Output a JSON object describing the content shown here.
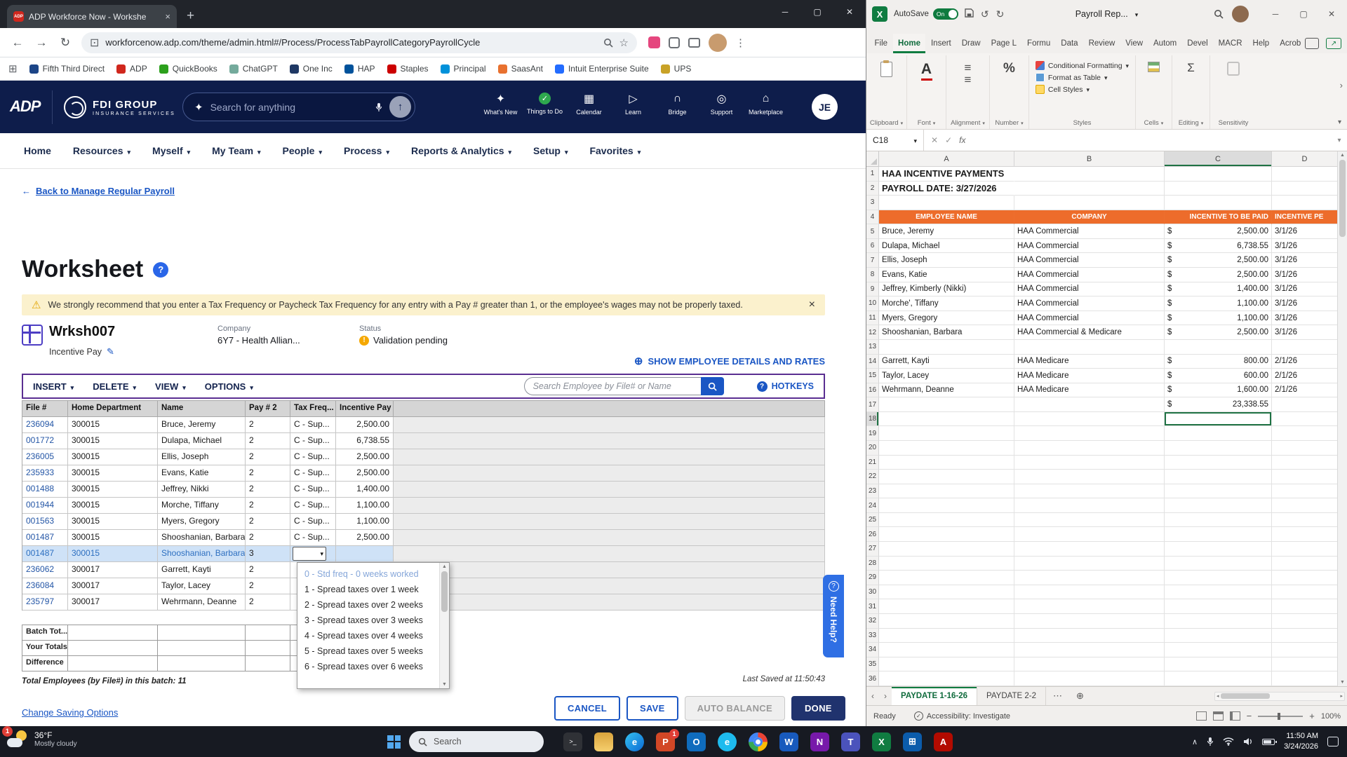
{
  "browser": {
    "tab_title": "ADP Workforce Now - Workshe",
    "tab_favicon": "ADP",
    "url": "workforcenow.adp.com/theme/admin.html#/Process/ProcessTabPayrollCategoryPayrollCycle",
    "bookmarks": [
      {
        "label": "Fifth Third Direct",
        "color": "#1c4587"
      },
      {
        "label": "ADP",
        "color": "#d0271d"
      },
      {
        "label": "QuickBooks",
        "color": "#2ca01c"
      },
      {
        "label": "ChatGPT",
        "color": "#74aa9c"
      },
      {
        "label": "One Inc",
        "color": "#1f3864"
      },
      {
        "label": "HAP",
        "color": "#00529b"
      },
      {
        "label": "Staples",
        "color": "#cc0000"
      },
      {
        "label": "Principal",
        "color": "#0091da"
      },
      {
        "label": "SaasAnt",
        "color": "#e8712f"
      },
      {
        "label": "Intuit Enterprise Suite",
        "color": "#236cff"
      },
      {
        "label": "UPS",
        "color": "#c9a227"
      }
    ]
  },
  "adp": {
    "logo": "ADP",
    "brand_line1": "FDI GROUP",
    "brand_line2": "INSURANCE SERVICES",
    "search_placeholder": "Search for anything",
    "header_items": [
      {
        "label": "What's New",
        "glyph": "✦"
      },
      {
        "label": "Things to Do",
        "glyph": "✓",
        "check": true
      },
      {
        "label": "Calendar",
        "glyph": "▦"
      },
      {
        "label": "Learn",
        "glyph": "▷"
      },
      {
        "label": "Bridge",
        "glyph": "∩"
      },
      {
        "label": "Support",
        "glyph": "◎"
      },
      {
        "label": "Marketplace",
        "glyph": "⌂"
      }
    ],
    "avatar": "JE",
    "nav_items": [
      {
        "label": "Home",
        "caret": false
      },
      {
        "label": "Resources",
        "caret": true
      },
      {
        "label": "Myself",
        "caret": true
      },
      {
        "label": "My Team",
        "caret": true
      },
      {
        "label": "People",
        "caret": true
      },
      {
        "label": "Process",
        "caret": true
      },
      {
        "label": "Reports & Analytics",
        "caret": true
      },
      {
        "label": "Setup",
        "caret": true
      },
      {
        "label": "Favorites",
        "caret": true
      }
    ],
    "back_link": "Back to Manage Regular Payroll",
    "page_title": "Worksheet",
    "warning_text": "We strongly recommend that you enter a Tax Frequency or Paycheck Tax Frequency for any entry with a Pay # greater than 1, or the employee's wages may not be properly taxed.",
    "worksheet_id": "Wrksh007",
    "worksheet_type": "Incentive Pay",
    "company_label": "Company",
    "company_value": "6Y7 - Health Allian...",
    "status_label": "Status",
    "status_value": "Validation pending",
    "show_details_link": "SHOW EMPLOYEE DETAILS AND RATES",
    "menu_buttons": [
      {
        "label": "INSERT"
      },
      {
        "label": "DELETE"
      },
      {
        "label": "VIEW"
      },
      {
        "label": "OPTIONS"
      }
    ],
    "employee_search_placeholder": "Search Employee by File# or Name",
    "hotkeys_label": "HOTKEYS",
    "grid": {
      "headers": [
        "File #",
        "Home Department",
        "Name",
        "Pay # 2",
        "Tax Freq...",
        "Incentive Pay"
      ],
      "rows": [
        {
          "file": "236094",
          "dept": "300015",
          "name": "Bruce, Jeremy",
          "pay": "2",
          "tax": "C - Sup...",
          "incentive": "2,500.00",
          "selected": false,
          "combo": false
        },
        {
          "file": "001772",
          "dept": "300015",
          "name": "Dulapa, Michael",
          "pay": "2",
          "tax": "C - Sup...",
          "incentive": "6,738.55",
          "selected": false,
          "combo": false
        },
        {
          "file": "236005",
          "dept": "300015",
          "name": "Ellis, Joseph",
          "pay": "2",
          "tax": "C - Sup...",
          "incentive": "2,500.00",
          "selected": false,
          "combo": false
        },
        {
          "file": "235933",
          "dept": "300015",
          "name": "Evans, Katie",
          "pay": "2",
          "tax": "C - Sup...",
          "incentive": "2,500.00",
          "selected": false,
          "combo": false
        },
        {
          "file": "001488",
          "dept": "300015",
          "name": "Jeffrey, Nikki",
          "pay": "2",
          "tax": "C - Sup...",
          "incentive": "1,400.00",
          "selected": false,
          "combo": false
        },
        {
          "file": "001944",
          "dept": "300015",
          "name": "Morche, Tiffany",
          "pay": "2",
          "tax": "C - Sup...",
          "incentive": "1,100.00",
          "selected": false,
          "combo": false
        },
        {
          "file": "001563",
          "dept": "300015",
          "name": "Myers, Gregory",
          "pay": "2",
          "tax": "C - Sup...",
          "incentive": "1,100.00",
          "selected": false,
          "combo": false
        },
        {
          "file": "001487",
          "dept": "300015",
          "name": "Shooshanian, Barbara",
          "pay": "2",
          "tax": "C - Sup...",
          "incentive": "2,500.00",
          "selected": false,
          "combo": false
        },
        {
          "file": "001487",
          "dept": "300015",
          "name": "Shooshanian, Barbara",
          "pay": "3",
          "tax": "",
          "incentive": "",
          "selected": true,
          "combo": true
        },
        {
          "file": "236062",
          "dept": "300017",
          "name": "Garrett, Kayti",
          "pay": "2",
          "tax": "",
          "incentive": "",
          "selected": false,
          "combo": false
        },
        {
          "file": "236084",
          "dept": "300017",
          "name": "Taylor, Lacey",
          "pay": "2",
          "tax": "",
          "incentive": "",
          "selected": false,
          "combo": false
        },
        {
          "file": "235797",
          "dept": "300017",
          "name": "Wehrmann, Deanne",
          "pay": "2",
          "tax": "",
          "incentive": "",
          "selected": false,
          "combo": false
        }
      ],
      "footer_rows": [
        {
          "label": "Batch Tot..."
        },
        {
          "label": "Your Totals"
        },
        {
          "label": "Difference"
        }
      ]
    },
    "tax_freq_options": [
      {
        "label": "0 - Std freq - 0 weeks worked",
        "hl": true
      },
      {
        "label": "1 - Spread taxes over 1 week",
        "hl": false
      },
      {
        "label": "2 - Spread taxes over 2 weeks",
        "hl": false
      },
      {
        "label": "3 - Spread taxes over 3 weeks",
        "hl": false
      },
      {
        "label": "4 - Spread taxes over 4 weeks",
        "hl": false
      },
      {
        "label": "5 - Spread taxes over 5 weeks",
        "hl": false
      },
      {
        "label": "6 - Spread taxes over 6 weeks",
        "hl": false
      }
    ],
    "total_employees_text": "Total Employees (by File#) in this batch: 11",
    "last_saved_text": "Last Saved at 11:50:43",
    "change_saving_link": "Change Saving Options",
    "buttons": {
      "cancel": "CANCEL",
      "save": "SAVE",
      "auto_balance": "AUTO BALANCE",
      "done": "DONE"
    },
    "need_help_label": "Need Help?"
  },
  "excel": {
    "title": {
      "autosave_label": "AutoSave",
      "autosave_state": "On",
      "file_name": "Payroll Rep..."
    },
    "ribbon": {
      "tabs": [
        {
          "label": "File",
          "active": false
        },
        {
          "label": "Home",
          "active": true
        },
        {
          "label": "Insert",
          "active": false
        },
        {
          "label": "Draw",
          "active": false
        },
        {
          "label": "Page L",
          "active": false
        },
        {
          "label": "Formu",
          "active": false
        },
        {
          "label": "Data",
          "active": false
        },
        {
          "label": "Review",
          "active": false
        },
        {
          "label": "View",
          "active": false
        },
        {
          "label": "Autom",
          "active": false
        },
        {
          "label": "Devel",
          "active": false
        },
        {
          "label": "MACR",
          "active": false
        },
        {
          "label": "Help",
          "active": false
        },
        {
          "label": "Acrob",
          "active": false
        }
      ],
      "groups": {
        "clipboard": "Clipboard",
        "font": "Font",
        "alignment": "Alignment",
        "number": "Number",
        "styles": "Styles",
        "cells": "Cells",
        "editing": "Editing",
        "sensitivity": "Sensitivity"
      },
      "style_buttons": [
        {
          "label": "Conditional Formatting"
        },
        {
          "label": "Format as Table"
        },
        {
          "label": "Cell Styles"
        }
      ]
    },
    "formula": {
      "name_box": "C18",
      "fx": "fx"
    },
    "sheet": {
      "columns": [
        "A",
        "B",
        "C",
        "D"
      ],
      "row_count": 36,
      "title1": "HAA INCENTIVE PAYMENTS",
      "title2": "PAYROLL DATE: 3/27/2026",
      "header_row": 4,
      "headers": [
        "EMPLOYEE NAME",
        "COMPANY",
        "INCENTIVE TO BE PAID",
        "INCENTIVE PE"
      ],
      "currency": "$",
      "data_rows": [
        {
          "n": 5,
          "name": "Bruce, Jeremy",
          "company": "HAA Commercial",
          "amount": "2,500.00",
          "date": "3/1/26"
        },
        {
          "n": 6,
          "name": "Dulapa, Michael",
          "company": "HAA Commercial",
          "amount": "6,738.55",
          "date": "3/1/26"
        },
        {
          "n": 7,
          "name": "Ellis, Joseph",
          "company": "HAA Commercial",
          "amount": "2,500.00",
          "date": "3/1/26"
        },
        {
          "n": 8,
          "name": "Evans, Katie",
          "company": "HAA Commercial",
          "amount": "2,500.00",
          "date": "3/1/26"
        },
        {
          "n": 9,
          "name": "Jeffrey, Kimberly (Nikki)",
          "company": "HAA Commercial",
          "amount": "1,400.00",
          "date": "3/1/26"
        },
        {
          "n": 10,
          "name": "Morche', Tiffany",
          "company": "HAA Commercial",
          "amount": "1,100.00",
          "date": "3/1/26"
        },
        {
          "n": 11,
          "name": "Myers, Gregory",
          "company": "HAA Commercial",
          "amount": "1,100.00",
          "date": "3/1/26"
        },
        {
          "n": 12,
          "name": "Shooshanian, Barbara",
          "company": "HAA Commercial & Medicare",
          "amount": "2,500.00",
          "date": "3/1/26"
        },
        {
          "n": 14,
          "name": "Garrett, Kayti",
          "company": "HAA Medicare",
          "amount": "800.00",
          "date": "2/1/26"
        },
        {
          "n": 15,
          "name": "Taylor, Lacey",
          "company": "HAA Medicare",
          "amount": "600.00",
          "date": "2/1/26"
        },
        {
          "n": 16,
          "name": "Wehrmann, Deanne",
          "company": "HAA Medicare",
          "amount": "1,600.00",
          "date": "2/1/26"
        }
      ],
      "total_row": 17,
      "total_amount": "23,338.55",
      "selected_row": 18,
      "selected_col": "C"
    },
    "sheet_tabs": [
      {
        "label": "PAYDATE 1-16-26",
        "active": true
      },
      {
        "label": "PAYDATE 2-2",
        "active": false
      }
    ],
    "status": {
      "ready": "Ready",
      "accessibility": "Accessibility: Investigate",
      "zoom": "100%"
    }
  },
  "taskbar": {
    "weather_temp": "36°F",
    "weather_desc": "Mostly cloudy",
    "weather_badge": "1",
    "search_placeholder": "Search",
    "apps": [
      {
        "app": "command-prompt",
        "glyph": ">_",
        "color": "#2f3136"
      },
      {
        "app": "file-explorer",
        "glyph": "",
        "color": ""
      },
      {
        "app": "edge",
        "glyph": "e",
        "color": ""
      },
      {
        "app": "powerpoint",
        "glyph": "P",
        "color": "#d24726",
        "badge": "1"
      },
      {
        "app": "outlook",
        "glyph": "O",
        "color": "#0f6cbd"
      },
      {
        "app": "internet-explorer",
        "glyph": "e",
        "color": "#1ebbee"
      },
      {
        "app": "chrome",
        "glyph": "",
        "color": ""
      },
      {
        "app": "word",
        "glyph": "W",
        "color": "#185abd"
      },
      {
        "app": "onenote",
        "glyph": "N",
        "color": "#7719aa"
      },
      {
        "app": "teams",
        "glyph": "T",
        "color": "#4b53bc"
      },
      {
        "app": "excel",
        "glyph": "X",
        "color": "#107c41"
      },
      {
        "app": "store",
        "glyph": "⊞",
        "color": "#0b5cab"
      },
      {
        "app": "acrobat",
        "glyph": "A",
        "color": "#b30b00"
      }
    ],
    "time": "11:50 AM",
    "date": "3/24/2026"
  }
}
